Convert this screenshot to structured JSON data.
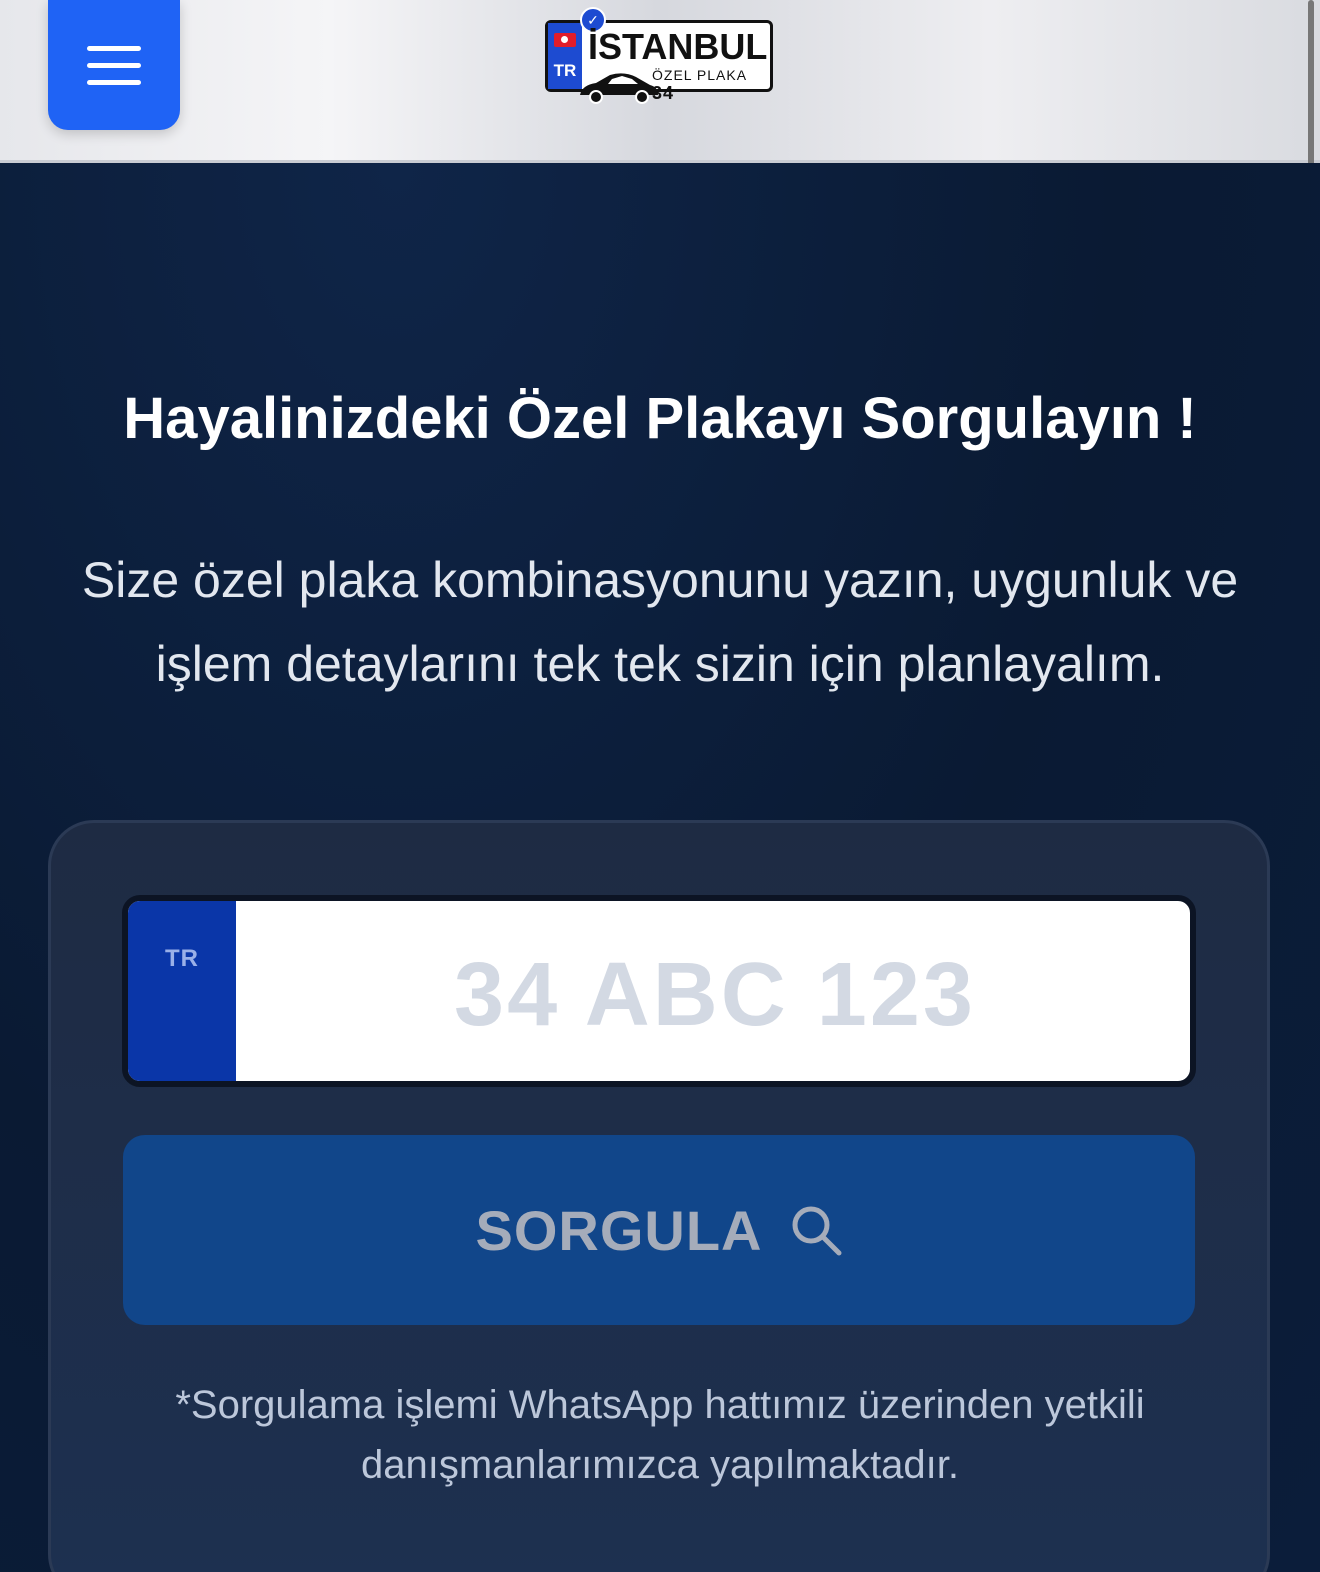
{
  "header": {
    "menu_icon": "hamburger-icon",
    "logo": {
      "title": "İSTANBUL",
      "subtitle": "ÖZEL PLAKA",
      "number": "34",
      "country_code": "TR",
      "verified_icon": "check-badge-icon"
    }
  },
  "hero": {
    "title": "Hayalinizdeki Özel Plakayı Sorgulayın !",
    "description": "Size özel plaka kombinasyonunu yazın, uygunluk ve işlem detaylarını tek tek sizin için planlayalım."
  },
  "form": {
    "plate_country": "TR",
    "plate_placeholder": "34 ABC 123",
    "plate_value": "",
    "submit_label": "SORGULA",
    "submit_icon": "search-icon",
    "note": "*Sorgulama işlemi WhatsApp hattımız üzerinden yetkili danışmanlarımızca yapılmaktadır."
  },
  "colors": {
    "menu_button": "#1f63f5",
    "background": "#0a1a33",
    "card": "#1e2b43",
    "plate_blue": "#0a36a8",
    "submit_button": "#11468a"
  }
}
